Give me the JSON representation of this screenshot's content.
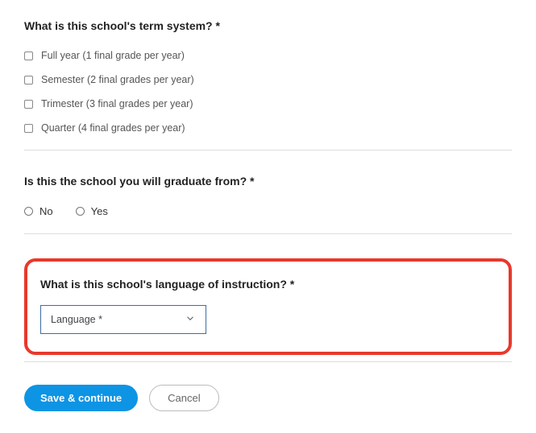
{
  "termSystem": {
    "question": "What is this school's term system? *",
    "options": [
      "Full year (1 final grade per year)",
      "Semester (2 final grades per year)",
      "Trimester (3 final grades per year)",
      "Quarter (4 final grades per year)"
    ]
  },
  "graduate": {
    "question": "Is this the school you will graduate from? *",
    "no": "No",
    "yes": "Yes"
  },
  "language": {
    "question": "What is this school's language of instruction? *",
    "placeholder": "Language *"
  },
  "buttons": {
    "save": "Save & continue",
    "cancel": "Cancel"
  }
}
